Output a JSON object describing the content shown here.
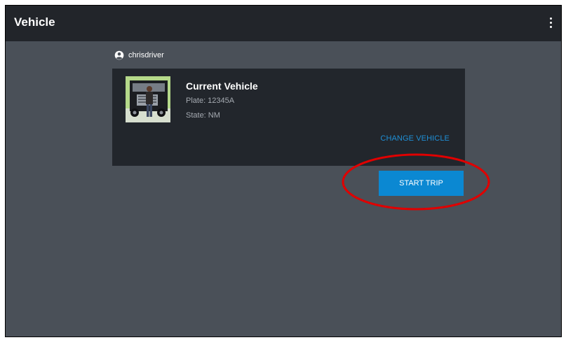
{
  "app_bar": {
    "title": "Vehicle",
    "menu_icon": "more-vert-icon"
  },
  "user": {
    "icon": "account-circle-icon",
    "name": "chrisdriver"
  },
  "vehicle": {
    "photo_icon": "truck-with-driver-photo",
    "title": "Current Vehicle",
    "plate": "Plate: 12345A",
    "state": "State: NM",
    "change_label": "CHANGE VEHICLE"
  },
  "actions": {
    "start_trip_label": "START TRIP"
  },
  "colors": {
    "app_bar": "#22252a",
    "background": "#4a5058",
    "card": "#22262c",
    "accent": "#0b88d2",
    "link": "#1f8fd6",
    "annotation": "#e00000"
  }
}
